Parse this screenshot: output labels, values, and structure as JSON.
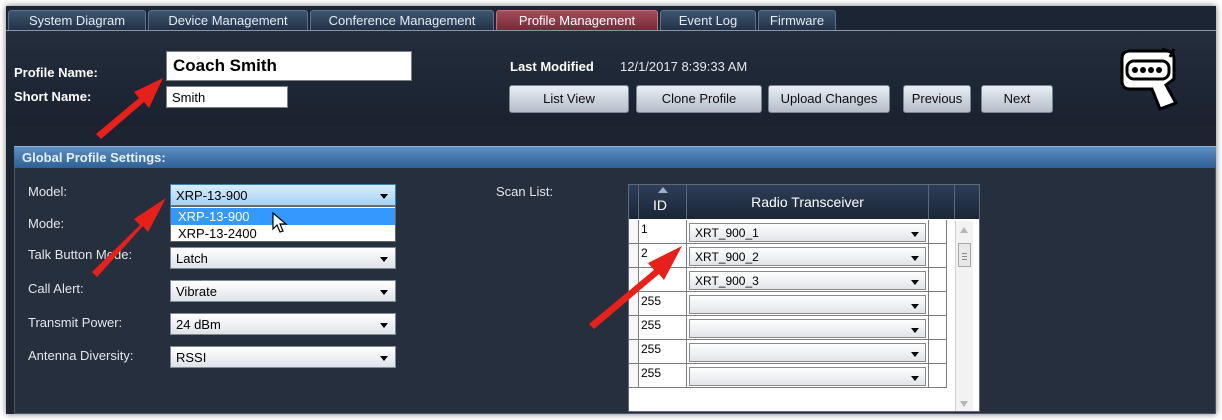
{
  "tabs": [
    {
      "label": "System Diagram"
    },
    {
      "label": "Device Management"
    },
    {
      "label": "Conference Management"
    },
    {
      "label": "Profile Management"
    },
    {
      "label": "Event Log"
    },
    {
      "label": "Firmware"
    }
  ],
  "header": {
    "profile_name_label": "Profile Name:",
    "profile_name_value": "Coach Smith",
    "short_name_label": "Short Name:",
    "short_name_value": "Smith",
    "last_modified_label": "Last Modified",
    "last_modified_value": "12/1/2017 8:39:33 AM",
    "buttons": {
      "list_view": "List View",
      "clone_profile": "Clone Profile",
      "upload_changes": "Upload Changes",
      "previous": "Previous",
      "next": "Next"
    }
  },
  "global_settings": {
    "title": "Global Profile Settings:",
    "model_label": "Model:",
    "model_value": "XRP-13-900",
    "model_options": [
      "XRP-13-900",
      "XRP-13-2400"
    ],
    "mode_label": "Mode:",
    "talk_button_label": "Talk Button Mode:",
    "talk_button_value": "Latch",
    "call_alert_label": "Call Alert:",
    "call_alert_value": "Vibrate",
    "transmit_power_label": "Transmit Power:",
    "transmit_power_value": "24 dBm",
    "antenna_label": "Antenna Diversity:",
    "antenna_value": "RSSI",
    "scan_list_label": "Scan List:"
  },
  "scan_grid": {
    "col_id": "ID",
    "col_radio": "Radio Transceiver",
    "rows": [
      {
        "id": "1",
        "radio": "XRT_900_1"
      },
      {
        "id": "2",
        "radio": "XRT_900_2"
      },
      {
        "id": "",
        "radio": "XRT_900_3"
      },
      {
        "id": "255",
        "radio": ""
      },
      {
        "id": "255",
        "radio": ""
      },
      {
        "id": "255",
        "radio": ""
      },
      {
        "id": "255",
        "radio": ""
      }
    ]
  },
  "colors": {
    "active_tab": "#8c3a47",
    "section_bar": "#3e73ab",
    "annotation_arrow": "#e8201a",
    "dropdown_highlight": "#3399ff"
  },
  "icons": {
    "logo": "headset-device-icon",
    "annotation": "red-arrow-icon"
  }
}
